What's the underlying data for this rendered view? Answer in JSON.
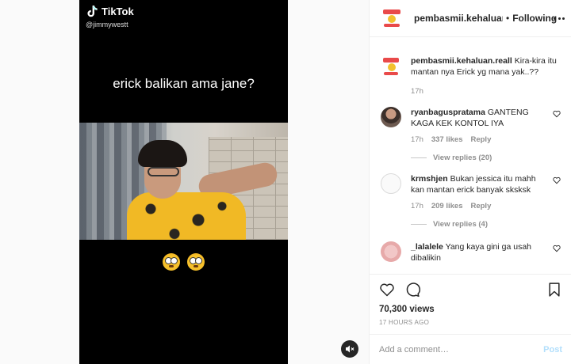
{
  "video": {
    "brand": "TikTok",
    "handle": "@jimmywestt",
    "caption": "erick balikan ama jane?",
    "emoji_icons": [
      "flushed-face-icon",
      "flushed-face-icon"
    ]
  },
  "header": {
    "username": "pembasmii.kehaluan.r",
    "dot": "•",
    "follow_label": "Following"
  },
  "comments": [
    {
      "username": "pembasmii.kehaluan.reall",
      "text": "Kira-kira itu mantan nya Erick yg mana yak..??",
      "time": "17h",
      "likes": "",
      "reply_label": "",
      "view_replies": "",
      "avatar": "page-logo"
    },
    {
      "username": "ryanbaguspratama",
      "text": "GANTENG KAGA KEK KONTOL IYA",
      "time": "17h",
      "likes": "337 likes",
      "reply_label": "Reply",
      "view_replies": "View replies (20)",
      "avatar": "photo"
    },
    {
      "username": "krmshjen",
      "text": "Bukan jessica itu mahh kan mantan erick banyak sksksk",
      "time": "17h",
      "likes": "209 likes",
      "reply_label": "Reply",
      "view_replies": "View replies (4)",
      "avatar": "blank"
    },
    {
      "username": "_lalalele",
      "text": "Yang kaya gini ga usah dibalikin",
      "time": "",
      "likes": "",
      "reply_label": "",
      "view_replies": "",
      "avatar": "pink"
    }
  ],
  "actions": {
    "views": "70,300 views",
    "time": "17 HOURS AGO",
    "icons": [
      "heart-icon",
      "comment-icon",
      "bookmark-icon"
    ]
  },
  "add_comment": {
    "placeholder": "Add a comment…",
    "post_label": "Post"
  },
  "colors": {
    "text": "#262626",
    "muted": "#8e8e8e",
    "post_disabled": "#b2dffc",
    "border": "#efefef"
  }
}
